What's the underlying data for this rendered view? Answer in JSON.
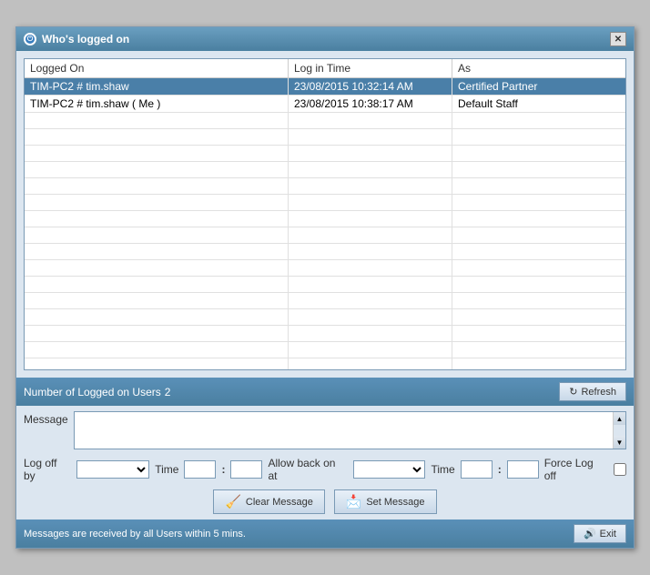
{
  "window": {
    "title": "Who's logged on",
    "title_icon": "power-icon"
  },
  "table": {
    "columns": [
      "Logged On",
      "Log in Time",
      "As"
    ],
    "rows": [
      {
        "logged_on": "TIM-PC2 # tim.shaw",
        "login_time": "23/08/2015 10:32:14 AM",
        "as": "Certified Partner",
        "selected": true
      },
      {
        "logged_on": "TIM-PC2 # tim.shaw ( Me )",
        "login_time": "23/08/2015 10:38:17 AM",
        "as": "Default Staff",
        "selected": false
      }
    ],
    "empty_rows": 16
  },
  "status": {
    "logged_on_label": "Number of Logged on Users",
    "count": "2",
    "refresh_label": "Refresh"
  },
  "message": {
    "label": "Message",
    "placeholder": "",
    "value": ""
  },
  "logoff": {
    "label": "Log off by",
    "time_label": "Time",
    "colon": ":",
    "allow_label": "Allow back on at",
    "time_label2": "Time",
    "colon2": ":",
    "force_label": "Force Log off"
  },
  "buttons": {
    "clear_message": "Clear Message",
    "set_message": "Set Message"
  },
  "footer": {
    "message": "Messages are received  by all Users within 5 mins.",
    "exit_label": "Exit"
  }
}
